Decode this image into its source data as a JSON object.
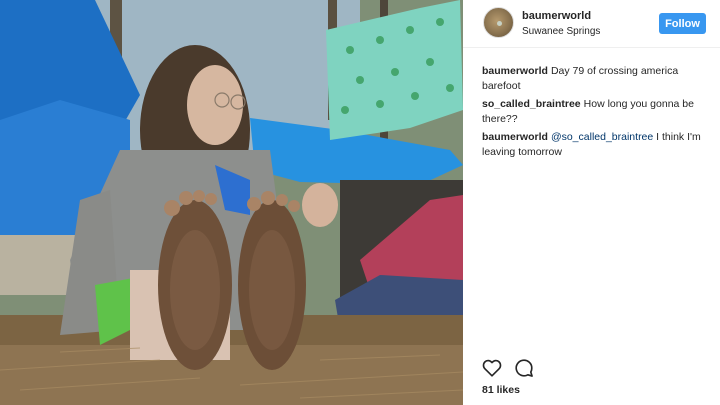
{
  "post": {
    "photo_alt": "photo-of-barefoot-traveler-at-campsite"
  },
  "header": {
    "username": "baumerworld",
    "location": "Suwanee Springs",
    "follow_label": "Follow"
  },
  "comments": [
    {
      "author": "baumerworld",
      "text": "Day 79 of crossing america barefoot"
    },
    {
      "author": "so_called_braintree",
      "text": "How long you gonna be there??"
    },
    {
      "author": "baumerworld",
      "mention": "@so_called_braintree",
      "text": " I think I'm leaving tomorrow"
    }
  ],
  "actions": {
    "like_icon": "heart-icon",
    "comment_icon": "comment-bubble-icon"
  },
  "likes_text": "81 likes",
  "colors": {
    "follow_button": "#3897f0",
    "text": "#262626",
    "mention": "#003569"
  }
}
